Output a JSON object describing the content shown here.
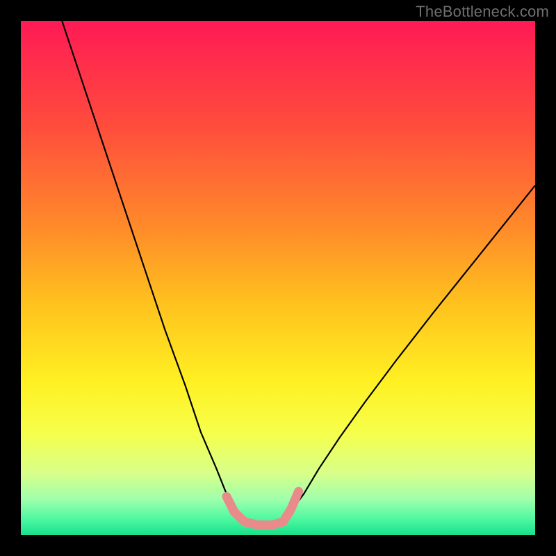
{
  "watermark": "TheBottleneck.com",
  "chart_data": {
    "type": "line",
    "title": "",
    "xlabel": "",
    "ylabel": "",
    "xlim": [
      0,
      100
    ],
    "ylim": [
      0,
      100
    ],
    "grid": false,
    "legend": false,
    "background": {
      "type": "vertical-gradient",
      "stops": [
        {
          "pos": 0.0,
          "color": "#ff1a55"
        },
        {
          "pos": 0.2,
          "color": "#ff4b3d"
        },
        {
          "pos": 0.4,
          "color": "#ff8a2a"
        },
        {
          "pos": 0.55,
          "color": "#ffc21e"
        },
        {
          "pos": 0.7,
          "color": "#fff022"
        },
        {
          "pos": 0.8,
          "color": "#f6ff4a"
        },
        {
          "pos": 0.88,
          "color": "#d8ff8a"
        },
        {
          "pos": 0.93,
          "color": "#9fffab"
        },
        {
          "pos": 0.97,
          "color": "#4cf7a1"
        },
        {
          "pos": 1.0,
          "color": "#18e08a"
        }
      ]
    },
    "series": [
      {
        "name": "curve-left",
        "stroke": "#000000",
        "width": 2.2,
        "x": [
          8,
          12,
          16,
          20,
          24,
          28,
          32,
          35,
          38,
          40,
          41.5,
          43,
          44
        ],
        "y": [
          100,
          88,
          76,
          64,
          52,
          40,
          29,
          20,
          13,
          8,
          5,
          3,
          2
        ]
      },
      {
        "name": "curve-right",
        "stroke": "#000000",
        "width": 2.2,
        "x": [
          50,
          52,
          55,
          58,
          62,
          67,
          73,
          80,
          88,
          96,
          100
        ],
        "y": [
          2,
          4,
          8,
          13,
          19,
          26,
          34,
          43,
          53,
          63,
          68
        ]
      },
      {
        "name": "marker-bottom",
        "stroke": "#e98b8b",
        "width": 13,
        "linecap": "round",
        "x": [
          40,
          41.5,
          43.5,
          46,
          49,
          51,
          52.5,
          54
        ],
        "y": [
          7.5,
          4.5,
          2.6,
          2.0,
          2.0,
          2.6,
          5.0,
          8.5
        ]
      }
    ]
  }
}
